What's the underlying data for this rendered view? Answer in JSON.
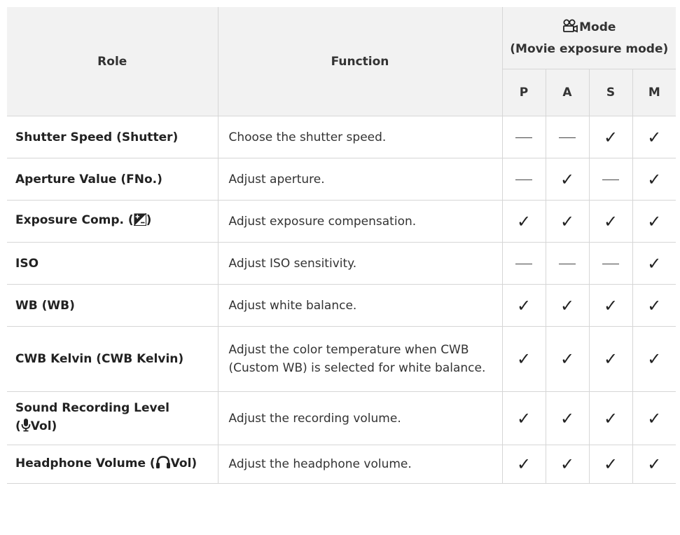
{
  "table": {
    "header": {
      "role": "Role",
      "function": "Function",
      "mode_label": "Mode",
      "mode_sub": "(Movie exposure mode)",
      "mode_icon": "movie-camera-icon",
      "modes": [
        "P",
        "A",
        "S",
        "M"
      ]
    },
    "rows": [
      {
        "role": "Shutter Speed (Shutter)",
        "function": "Choose the shutter speed.",
        "marks": [
          "—",
          "—",
          "✓",
          "✓"
        ]
      },
      {
        "role": "Aperture Value (FNo.)",
        "function": "Adjust aperture.",
        "marks": [
          "—",
          "✓",
          "—",
          "✓"
        ]
      },
      {
        "role_pre": "Exposure Comp. (",
        "role_icon": "exposure-compensation-icon",
        "role_post": ")",
        "function": "Adjust exposure compensation.",
        "marks": [
          "✓",
          "✓",
          "✓",
          "✓"
        ]
      },
      {
        "role": "ISO",
        "function": "Adjust ISO sensitivity.",
        "marks": [
          "—",
          "—",
          "—",
          "✓"
        ]
      },
      {
        "role": "WB (WB)",
        "function": "Adjust white balance.",
        "marks": [
          "✓",
          "✓",
          "✓",
          "✓"
        ]
      },
      {
        "role": "CWB Kelvin (CWB Kelvin)",
        "function": "Adjust the color temperature when CWB (Custom WB) is selected for white balance.",
        "marks": [
          "✓",
          "✓",
          "✓",
          "✓"
        ]
      },
      {
        "role_line1": "Sound Recording Level",
        "role_pre": "(",
        "role_icon": "microphone-icon",
        "role_post": "Vol)",
        "function": "Adjust the recording volume.",
        "marks": [
          "✓",
          "✓",
          "✓",
          "✓"
        ]
      },
      {
        "role_pre": "Headphone Volume (",
        "role_icon": "headphone-icon",
        "role_post": "Vol)",
        "function": "Adjust the headphone volume.",
        "marks": [
          "✓",
          "✓",
          "✓",
          "✓"
        ]
      }
    ]
  }
}
